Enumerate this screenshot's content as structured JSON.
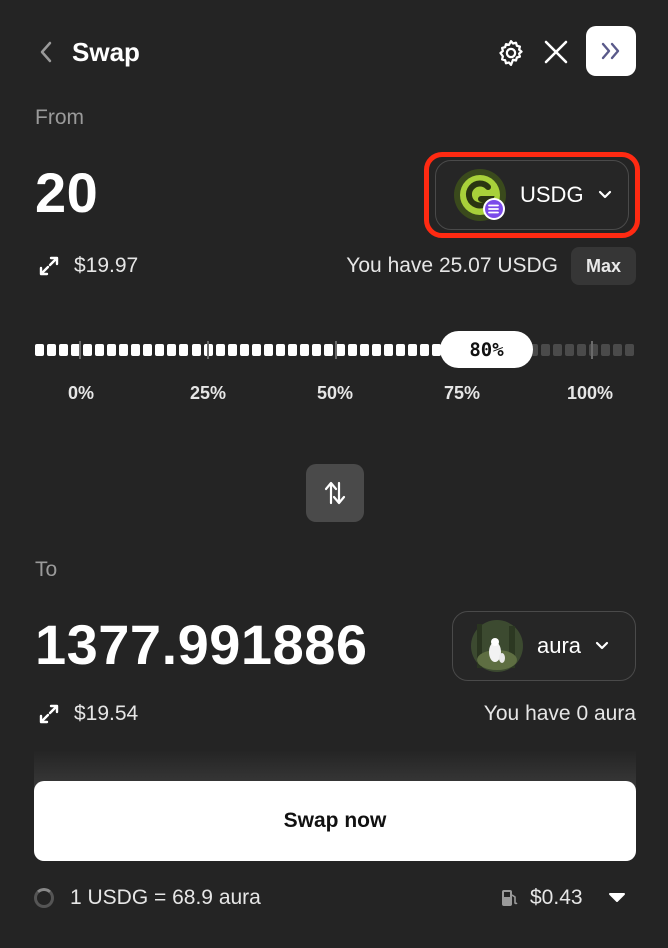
{
  "header": {
    "title": "Swap"
  },
  "from": {
    "label": "From",
    "amount": "20",
    "token": "USDG",
    "usd_value": "$19.97",
    "balance": "You have 25.07 USDG",
    "max_label": "Max"
  },
  "slider": {
    "value_label": "80%",
    "value_fraction": 0.8,
    "ticks": [
      "0%",
      "25%",
      "50%",
      "75%",
      "100%"
    ]
  },
  "to": {
    "label": "To",
    "amount": "1377.991886",
    "token": "aura",
    "usd_value": "$19.54",
    "balance": "You have 0 aura"
  },
  "action": {
    "swap_label": "Swap now"
  },
  "footer": {
    "rate": "1 USDG = 68.9 aura",
    "gas": "$0.43"
  },
  "colors": {
    "background": "#242424",
    "highlight": "#ff2a12",
    "usdg_green": "#a8d13a",
    "badge_purple": "#7b4bea"
  },
  "icons": [
    "chevron-left-icon",
    "gear-icon",
    "close-icon",
    "double-chevron-right-icon",
    "swap-arrows-icon",
    "flip-vertical-icon",
    "chevron-down-icon",
    "fuel-icon",
    "spinner-icon"
  ]
}
